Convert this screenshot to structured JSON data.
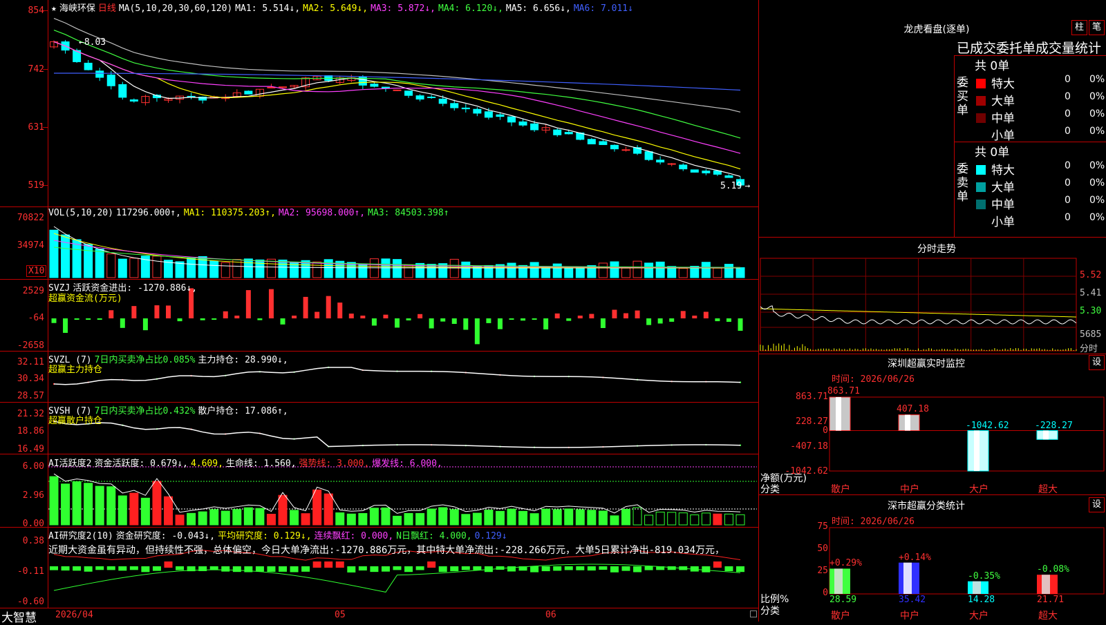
{
  "stock": {
    "star": "★",
    "name": "海峡环保",
    "period": "日线"
  },
  "ma_header": {
    "params": "MA(5,10,20,30,60,120)",
    "ma1": "MA1: 5.514↓,",
    "ma2": "MA2: 5.649↓,",
    "ma3": "MA3: 5.872↓,",
    "ma4": "MA4: 6.120↓,",
    "ma5": "MA5: 6.656↓,",
    "ma6": "MA6: 7.011↓"
  },
  "price_axis": [
    "854",
    "742",
    "631",
    "519"
  ],
  "price_marks": {
    "high": "8.03",
    "low": "5.19"
  },
  "vol_header": {
    "params": "VOL(5,10,20)",
    "value": "117296.000↑,",
    "ma1": "MA1: 110375.203↑,",
    "ma2": "MA2: 95698.000↑,",
    "ma3": "MA3: 84503.398↑"
  },
  "vol_axis": [
    "70822",
    "34974"
  ],
  "vol_unit": "X10",
  "svzj_header": {
    "name": "SVZJ",
    "text": "活跃资金进出: -1270.886↓,",
    "sub": "超赢资金流(万元)"
  },
  "svzj_axis": [
    "2529",
    "-64",
    "-2658"
  ],
  "svzl_header": {
    "name": "SVZL (7)",
    "text": "7日内买卖净占比0.085%",
    "hold": "主力持仓: 28.990↓,",
    "sub": "超赢主力持仓"
  },
  "svzl_axis": [
    "32.11",
    "30.34",
    "28.57"
  ],
  "svsh_header": {
    "name": "SVSH (7)",
    "text": "7日内买卖净占比0.432%",
    "hold": "散户持仓: 17.086↑,",
    "sub": "超赢散户持仓"
  },
  "svsh_axis": [
    "21.32",
    "18.86",
    "16.49"
  ],
  "ai1_header": {
    "name": "AI活跃度2",
    "a": "资金活跃度: 0.679↓,",
    "b": "4.609,",
    "c": "生命线: 1.560,",
    "d": "强势线: 3.000,",
    "e": "爆发线: 6.000,"
  },
  "ai1_axis": [
    "6.00",
    "2.96",
    "0.00"
  ],
  "ai2_header": {
    "name": "AI研究度2(10)",
    "a": "资金研究度: -0.043↓,",
    "b": "平均研究度: 0.129↓,",
    "c": "连续飘红: 0.000,",
    "d": "N日飘红: 4.000,",
    "e": "0.129↓"
  },
  "ai2_comment": "近期大资金虽有异动，但持续性不强，总体偏空，今日大单净流出:-1270.886万元，其中特大单净流出:-228.266万元，大单5日累计净出-819.034万元，",
  "ai2_axis": [
    "0.38",
    "-0.11",
    "-0.60"
  ],
  "dates": {
    "d1": "2026/04",
    "d2": "05",
    "d3": "06"
  },
  "brand": "大智慧",
  "right": {
    "dragon_title": "龙虎看盘(逐单)",
    "btn_zhu": "柱",
    "btn_bi": "笔",
    "stat_title": "已成交委托单成交量统计",
    "buy": {
      "total": "共 0单",
      "side": "委买单",
      "rows": [
        {
          "name": "特大",
          "count": "0",
          "pct": "0%",
          "color": "#ff0000"
        },
        {
          "name": "大单",
          "count": "0",
          "pct": "0%",
          "color": "#a00000"
        },
        {
          "name": "中单",
          "count": "0",
          "pct": "0%",
          "color": "#700000"
        },
        {
          "name": "小单",
          "count": "0",
          "pct": "0%",
          "color": "#000000"
        }
      ]
    },
    "sell": {
      "total": "共 0单",
      "side": "委卖单",
      "rows": [
        {
          "name": "特大",
          "count": "0",
          "pct": "0%",
          "color": "#00ffff"
        },
        {
          "name": "大单",
          "count": "0",
          "pct": "0%",
          "color": "#00a0a0"
        },
        {
          "name": "中单",
          "count": "0",
          "pct": "0%",
          "color": "#007070"
        },
        {
          "name": "小单",
          "count": "0",
          "pct": "0%",
          "color": "#000000"
        }
      ]
    },
    "intraday_title": "分时走势",
    "intraday_axis": [
      "5.52",
      "5.41",
      "5.30"
    ],
    "intraday_vol": "5685",
    "intraday_vol_label": "分时",
    "sz_title": "深圳超赢实时监控",
    "sz_btn": "设",
    "sz_time": "时间: 2026/06/26",
    "sz_axis": [
      "863.71",
      "228.27",
      "0",
      "-407.18",
      "-1042.62"
    ],
    "sz_ylabel": "净额(万元)",
    "sz_xlabel": "分类",
    "sz_bars": [
      {
        "cat": "散户",
        "value": 863.71,
        "label": "863.71"
      },
      {
        "cat": "中户",
        "value": 407.18,
        "label": "407.18"
      },
      {
        "cat": "大户",
        "value": -1042.62,
        "label": "-1042.62"
      },
      {
        "cat": "超大",
        "value": -228.27,
        "label": "-228.27"
      }
    ],
    "cls_title": "深市超赢分类统计",
    "cls_btn": "设",
    "cls_time": "时间: 2026/06/26",
    "cls_axis": [
      "75",
      "50",
      "25",
      "0"
    ],
    "cls_ylabel": "比例%",
    "cls_xlabel": "分类",
    "cls_bars": [
      {
        "cat": "散户",
        "value": 28.59,
        "label": "28.59",
        "chg": "+0.29%",
        "color": "#40ff40"
      },
      {
        "cat": "中户",
        "value": 35.42,
        "label": "35.42",
        "chg": "+0.14%",
        "color": "#3030ff"
      },
      {
        "cat": "大户",
        "value": 14.28,
        "label": "14.28",
        "chg": "-0.35%",
        "color": "#00ffff"
      },
      {
        "cat": "超大",
        "value": 21.71,
        "label": "21.71",
        "chg": "-0.08%",
        "color": "#ff2020"
      }
    ]
  },
  "chart_data": [
    {
      "type": "candlestick",
      "title": "",
      "ylabel": "",
      "ylim": [
        5.1,
        8.6
      ],
      "series": [
        {
          "name": "MA1",
          "color": "#ffffff"
        },
        {
          "name": "MA2",
          "color": "#ffff00"
        },
        {
          "name": "MA3",
          "color": "#ff40ff"
        },
        {
          "name": "MA4",
          "color": "#40ff40"
        },
        {
          "name": "MA5",
          "color": "#c0c0c0"
        },
        {
          "name": "MA6",
          "color": "#4060ff"
        }
      ]
    },
    {
      "type": "bar",
      "title": "",
      "ylabel": "",
      "ylim": [
        0,
        90000
      ]
    },
    {
      "type": "bar",
      "title": "",
      "ylabel": "",
      "ylim": [
        -2658,
        2529
      ]
    },
    {
      "type": "line",
      "title": "",
      "ylabel": "",
      "ylim": [
        28.57,
        32.11
      ]
    },
    {
      "type": "line",
      "title": "",
      "ylabel": "",
      "ylim": [
        16.49,
        21.32
      ]
    },
    {
      "type": "bar",
      "title": "",
      "ylabel": "",
      "ylim": [
        0,
        6
      ]
    },
    {
      "type": "bar",
      "title": "",
      "ylabel": "",
      "ylim": [
        -0.6,
        0.38
      ]
    },
    {
      "type": "bar",
      "title": "深圳超赢实时监控",
      "categories": [
        "散户",
        "中户",
        "大户",
        "超大"
      ],
      "values": [
        863.71,
        407.18,
        -1042.62,
        -228.27
      ],
      "ylim": [
        -1042.62,
        863.71
      ]
    },
    {
      "type": "bar",
      "title": "深市超赢分类统计",
      "categories": [
        "散户",
        "中户",
        "大户",
        "超大"
      ],
      "values": [
        28.59,
        35.42,
        14.28,
        21.71
      ],
      "ylim": [
        0,
        75
      ]
    }
  ]
}
